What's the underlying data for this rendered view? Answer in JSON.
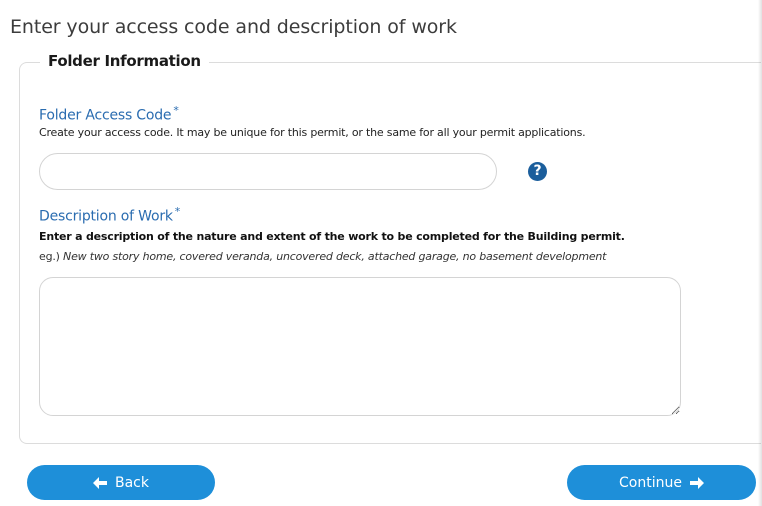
{
  "page": {
    "title": "Enter your access code and description of work"
  },
  "folder_info": {
    "legend": "Folder Information",
    "access_code": {
      "label": "Folder Access Code",
      "required_mark": "*",
      "hint": "Create your access code. It may be unique for this permit, or the same for all your permit applications.",
      "value": "",
      "placeholder": "",
      "help_icon": "question-circle-icon"
    },
    "description": {
      "label": "Description of Work",
      "required_mark": "*",
      "hint": "Enter a description of the nature and extent of the work to be completed for the Building permit.",
      "example_prefix": "eg.)",
      "example_text": "New two story home, covered veranda, uncovered deck, attached garage, no basement development",
      "value": "",
      "placeholder": ""
    }
  },
  "actions": {
    "back_label": "Back",
    "back_icon": "arrow-left-icon",
    "continue_label": "Continue",
    "continue_icon": "arrow-right-icon",
    "button_color": "#1e8fd9"
  },
  "colors": {
    "label_blue": "#2a6cb0",
    "help_icon_blue": "#1b5e9c"
  }
}
